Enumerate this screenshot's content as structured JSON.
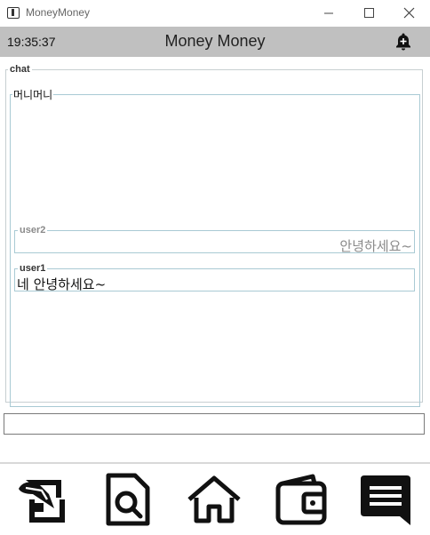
{
  "window": {
    "title": "MoneyMoney",
    "app_icon": "money-app-icon",
    "controls": [
      "minimize-icon",
      "maximize-icon",
      "close-icon"
    ]
  },
  "header": {
    "time": "19:35:37",
    "title": "Money Money",
    "notification_icon": "bell-plus-icon"
  },
  "chat": {
    "group_label": "chat",
    "room_name": "머니머니",
    "messages": [
      {
        "user": "user2",
        "text": "안녕하세요~",
        "align": "right"
      },
      {
        "user": "user1",
        "text": "네 안녕하세요~",
        "align": "left"
      }
    ],
    "input": {
      "value": "",
      "placeholder": ""
    }
  },
  "nav": {
    "items": [
      {
        "icon": "write-icon"
      },
      {
        "icon": "search-document-icon"
      },
      {
        "icon": "home-icon"
      },
      {
        "icon": "wallet-icon"
      },
      {
        "icon": "chat-icon",
        "active": true
      }
    ]
  },
  "colors": {
    "header_bg": "#c0c0c0",
    "border": "#a9cad4",
    "muted_text": "#8a8a8a"
  }
}
